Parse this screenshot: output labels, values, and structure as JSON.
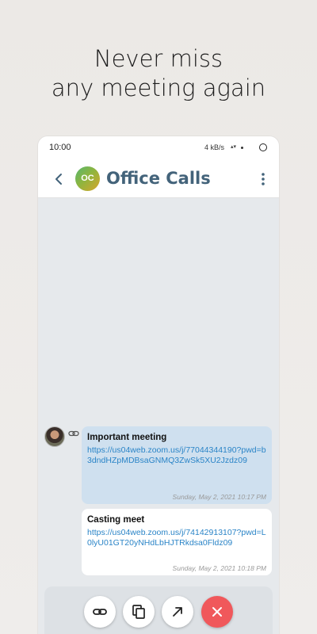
{
  "promo": {
    "line1": "Never miss",
    "line2": "any meeting again"
  },
  "status_bar": {
    "time": "10:00",
    "speed": "4 kB/s"
  },
  "chat": {
    "title": "Office Calls",
    "avatar_initials": "OC",
    "avatar_colors": [
      "#57b66f",
      "#8db53f",
      "#d9a52a"
    ]
  },
  "messages": [
    {
      "title": "Important meeting",
      "link": "https://us04web.zoom.us/j/77044344190?pwd=b3dndHZpMDBsaGNMQ3ZwSk5XU2Jzdz09",
      "timestamp": "Sunday, May 2, 2021 10:17 PM",
      "bubble_color": "#cfe0ef"
    },
    {
      "title": "Casting meet",
      "link": "https://us04web.zoom.us/j/74142913107?pwd=L0lyU01GT20yNHdLbHJTRkdsa0Fldz09",
      "timestamp": "Sunday, May 2, 2021 10:18 PM",
      "bubble_color": "#ffffff"
    }
  ],
  "actions": [
    {
      "icon": "link-icon"
    },
    {
      "icon": "copy-icon"
    },
    {
      "icon": "open-external-icon"
    },
    {
      "icon": "close-icon"
    }
  ],
  "colors": {
    "accent_title": "#43637a",
    "link": "#2a84c7",
    "delete": "#f0585b"
  }
}
